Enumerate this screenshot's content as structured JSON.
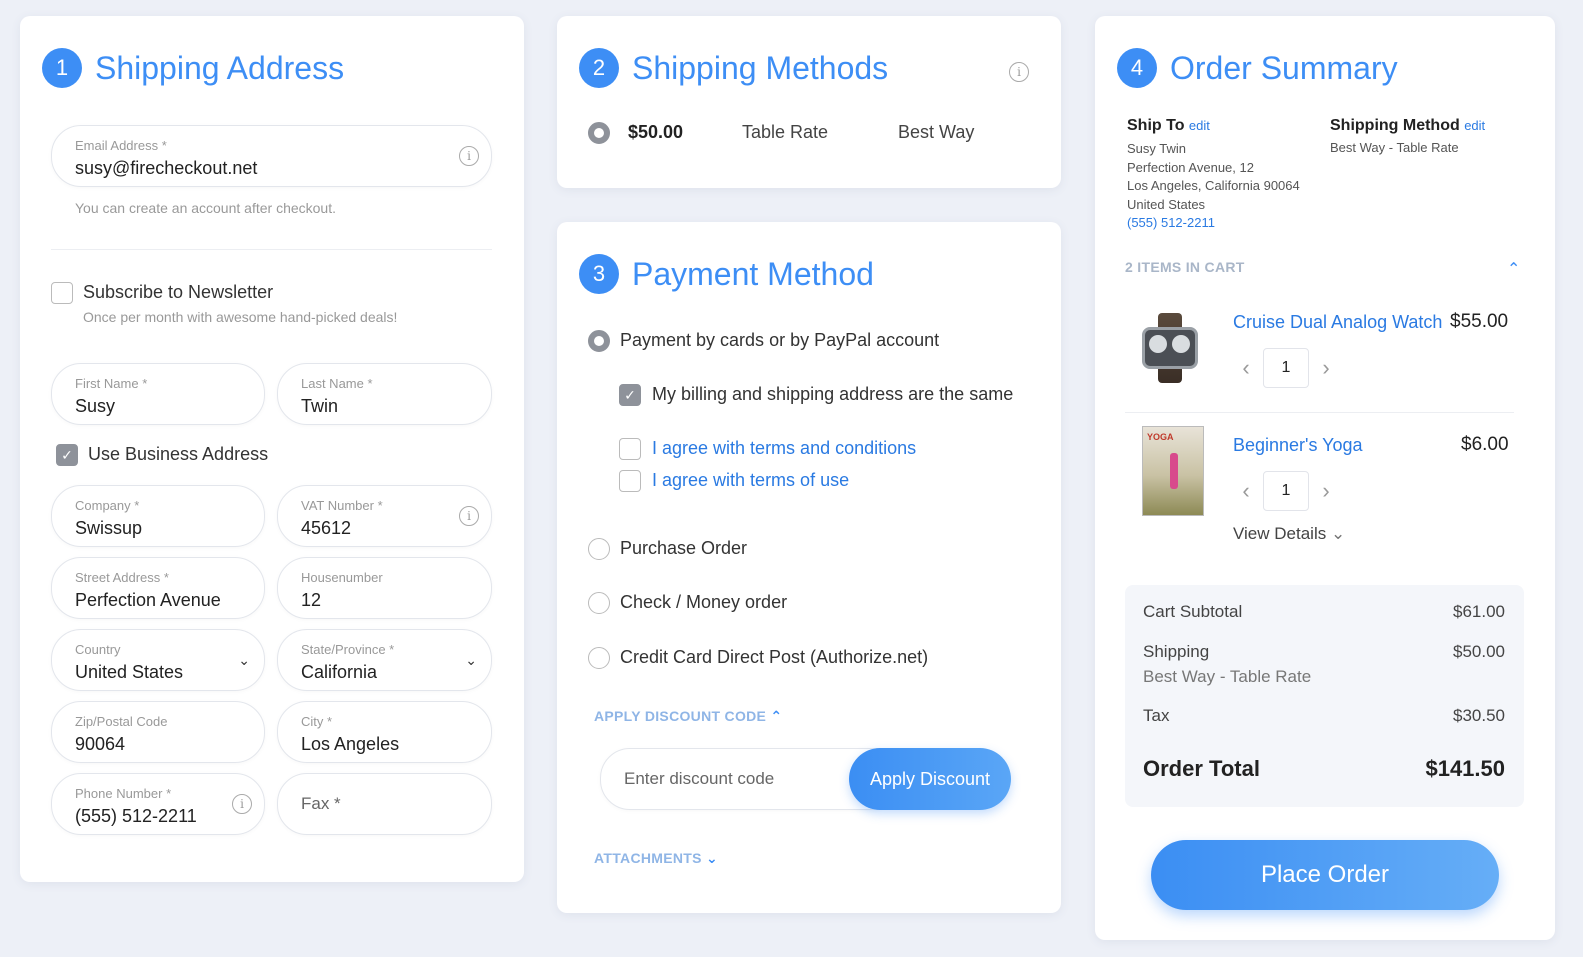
{
  "shipping_address": {
    "step": "1",
    "title": "Shipping Address",
    "email": {
      "label": "Email Address",
      "required": "*",
      "value": "susy@firecheckout.net"
    },
    "email_note": "You can create an account after checkout.",
    "newsletter": {
      "label": "Subscribe to Newsletter",
      "note": "Once per month with awesome hand-picked deals!"
    },
    "first_name": {
      "label": "First Name",
      "required": "*",
      "value": "Susy"
    },
    "last_name": {
      "label": "Last Name",
      "required": "*",
      "value": "Twin"
    },
    "use_business": "Use Business Address",
    "company": {
      "label": "Company",
      "required": "*",
      "value": "Swissup"
    },
    "vat": {
      "label": "VAT Number",
      "required": "*",
      "value": "45612"
    },
    "street": {
      "label": "Street Address",
      "required": "*",
      "value": "Perfection Avenue"
    },
    "housenumber": {
      "label": "Housenumber",
      "value": "12"
    },
    "country": {
      "label": "Country",
      "value": "United States"
    },
    "state": {
      "label": "State/Province",
      "required": "*",
      "value": "California"
    },
    "zip": {
      "label": "Zip/Postal Code",
      "value": "90064"
    },
    "city": {
      "label": "City",
      "required": "*",
      "value": "Los Angeles"
    },
    "phone": {
      "label": "Phone Number",
      "required": "*",
      "value": "(555) 512-2211"
    },
    "fax": {
      "placeholder": "Fax *"
    }
  },
  "shipping_methods": {
    "step": "2",
    "title": "Shipping Methods",
    "rate": {
      "price": "$50.00",
      "name": "Table Rate",
      "carrier": "Best Way"
    }
  },
  "payment": {
    "step": "3",
    "title": "Payment Method",
    "method_cards": "Payment by cards or by PayPal account",
    "same_address": "My billing and shipping address are the same",
    "agree_terms": "I agree with terms and conditions",
    "agree_use": "I agree with terms of use",
    "purchase_order": "Purchase Order",
    "check_money": "Check / Money order",
    "credit_card": "Credit Card Direct Post (Authorize.net)",
    "discount_toggle": "Apply Discount Code",
    "discount_placeholder": "Enter discount code",
    "apply_button": "Apply Discount",
    "attachments": "Attachments"
  },
  "summary": {
    "step": "4",
    "title": "Order Summary",
    "ship_to_label": "Ship To",
    "ship_method_label": "Shipping Method",
    "edit": "edit",
    "ship_to_lines": [
      "Susy Twin",
      "Perfection Avenue, 12",
      "Los Angeles, California 90064",
      "United States"
    ],
    "ship_to_phone": "(555) 512-2211",
    "ship_method_value": "Best Way - Table Rate",
    "items_count": "2 Items in Cart",
    "items": [
      {
        "name": "Cruise Dual Analog Watch",
        "price": "$55.00",
        "qty": "1"
      },
      {
        "name": "Beginner's Yoga",
        "price": "$6.00",
        "qty": "1",
        "details": "View Details",
        "cover_text": "YOGA"
      }
    ],
    "subtotal_label": "Cart Subtotal",
    "subtotal_value": "$61.00",
    "shipping_label": "Shipping",
    "shipping_sub": "Best Way - Table Rate",
    "shipping_value": "$50.00",
    "tax_label": "Tax",
    "tax_value": "$30.50",
    "total_label": "Order Total",
    "total_value": "$141.50",
    "place_order": "Place Order"
  },
  "colors": {
    "accent": "#3d8ef5",
    "background": "#edf0f7",
    "link": "#2a7ae2"
  }
}
